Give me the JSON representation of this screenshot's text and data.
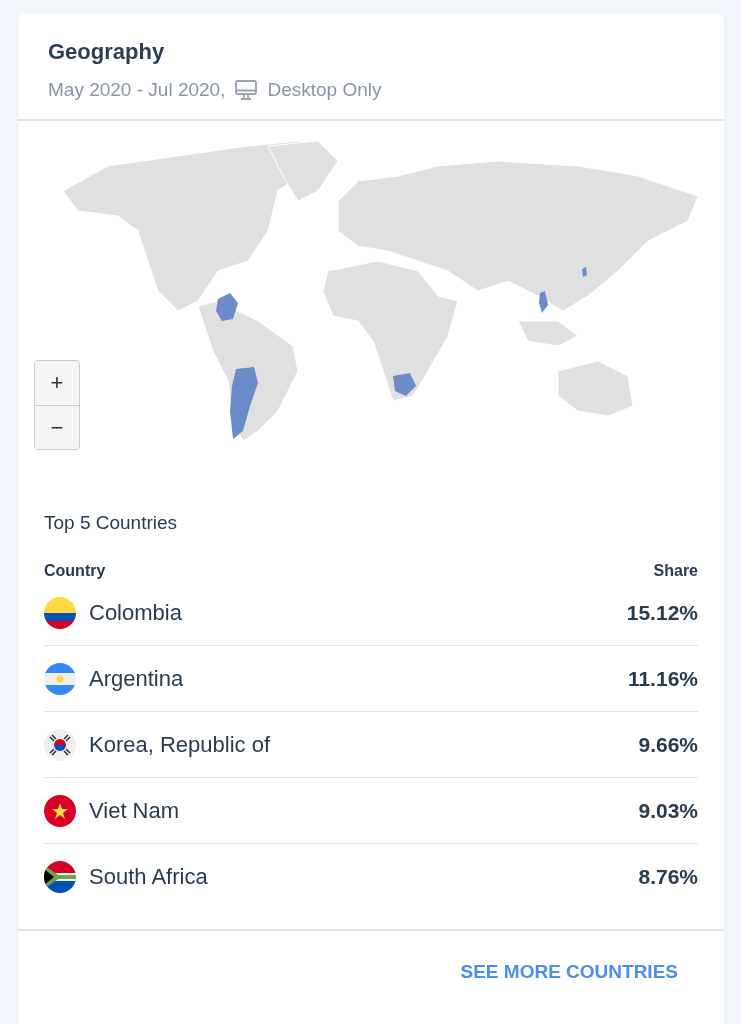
{
  "card": {
    "title": "Geography",
    "date_range": "May 2020 - Jul 2020,",
    "device": "Desktop Only"
  },
  "map": {
    "zoom_in": "+",
    "zoom_out": "−"
  },
  "table": {
    "title": "Top 5 Countries",
    "columns": [
      "Country",
      "Share"
    ],
    "rows": [
      {
        "country": "Colombia",
        "share": "15.12%"
      },
      {
        "country": "Argentina",
        "share": "11.16%"
      },
      {
        "country": "Korea, Republic of",
        "share": "9.66%"
      },
      {
        "country": "Viet Nam",
        "share": "9.03%"
      },
      {
        "country": "South Africa",
        "share": "8.76%"
      }
    ]
  },
  "footer": {
    "link": "SEE MORE COUNTRIES"
  }
}
